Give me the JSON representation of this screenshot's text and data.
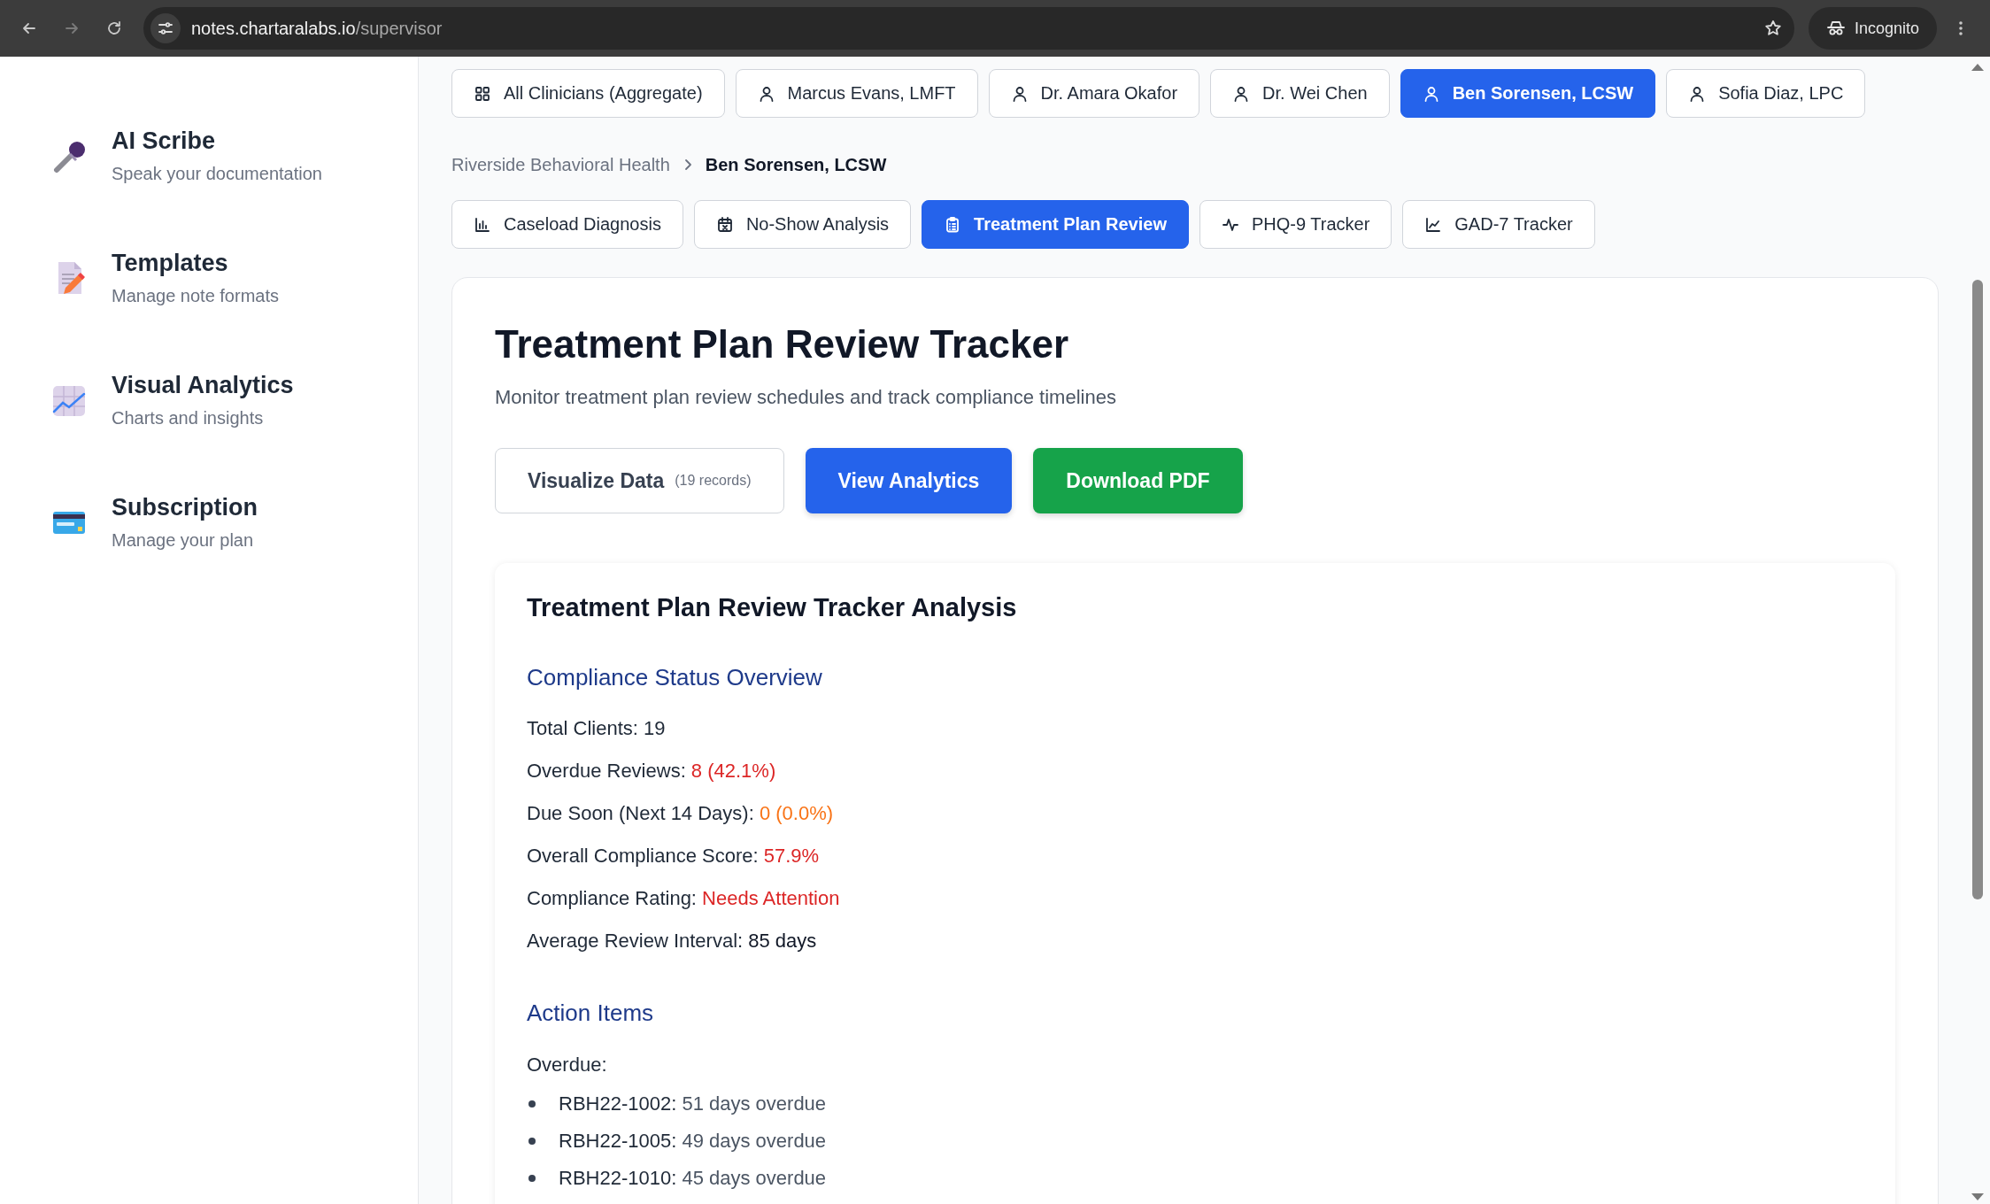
{
  "browser": {
    "url_host": "notes.chartaralabs.io",
    "url_path": "/supervisor",
    "profile_label": "Incognito"
  },
  "sidebar": {
    "items": [
      {
        "title": "AI Scribe",
        "subtitle": "Speak your documentation"
      },
      {
        "title": "Templates",
        "subtitle": "Manage note formats"
      },
      {
        "title": "Visual Analytics",
        "subtitle": "Charts and insights"
      },
      {
        "title": "Subscription",
        "subtitle": "Manage your plan"
      }
    ]
  },
  "clinician_tabs": [
    {
      "label": "All Clinicians (Aggregate)",
      "kind": "aggregate",
      "selected": false
    },
    {
      "label": "Marcus Evans, LMFT",
      "kind": "person",
      "selected": false
    },
    {
      "label": "Dr. Amara Okafor",
      "kind": "person",
      "selected": false
    },
    {
      "label": "Dr. Wei Chen",
      "kind": "person",
      "selected": false
    },
    {
      "label": "Ben Sorensen, LCSW",
      "kind": "person",
      "selected": true
    },
    {
      "label": "Sofia Diaz, LPC",
      "kind": "person",
      "selected": false
    }
  ],
  "breadcrumb": [
    {
      "label": "Riverside Behavioral Health",
      "current": false
    },
    {
      "label": "Ben Sorensen, LCSW",
      "current": true
    }
  ],
  "report_tabs": [
    {
      "label": "Caseload Diagnosis",
      "selected": false
    },
    {
      "label": "No-Show Analysis",
      "selected": false
    },
    {
      "label": "Treatment Plan Review",
      "selected": true
    },
    {
      "label": "PHQ-9 Tracker",
      "selected": false
    },
    {
      "label": "GAD-7 Tracker",
      "selected": false
    }
  ],
  "report": {
    "title": "Treatment Plan Review Tracker",
    "subtitle": "Monitor treatment plan review schedules and track compliance timelines",
    "actions": [
      {
        "label": "Visualize Data",
        "note": "(19 records)",
        "kind": "outline"
      },
      {
        "label": "View Analytics",
        "kind": "primary"
      },
      {
        "label": "Download PDF",
        "kind": "success"
      }
    ]
  },
  "analysis": {
    "title": "Treatment Plan Review Tracker Analysis",
    "overview": {
      "heading": "Compliance Status Overview",
      "lines": [
        {
          "label": "Total Clients:",
          "value": "19",
          "color": "#1f2937"
        },
        {
          "label": "Overdue Reviews:",
          "value": "8 (42.1%)",
          "color": "#dc2626"
        },
        {
          "label": "Due Soon (Next 14 Days):",
          "value": "0 (0.0%)",
          "color": "#f97316"
        },
        {
          "label": "Overall Compliance Score:",
          "value": "57.9%",
          "color": "#dc2626"
        },
        {
          "label": "Compliance Rating:",
          "value": "Needs Attention",
          "color": "#dc2626"
        },
        {
          "label": "Average Review Interval:",
          "value": "85 days",
          "color": "#111827"
        }
      ]
    },
    "action_items": {
      "heading": "Action Items",
      "group_label": "Overdue:",
      "items": [
        {
          "id": "RBH22-1002:",
          "text": "51 days overdue"
        },
        {
          "id": "RBH22-1005:",
          "text": "49 days overdue"
        },
        {
          "id": "RBH22-1010:",
          "text": "45 days overdue"
        }
      ]
    }
  }
}
